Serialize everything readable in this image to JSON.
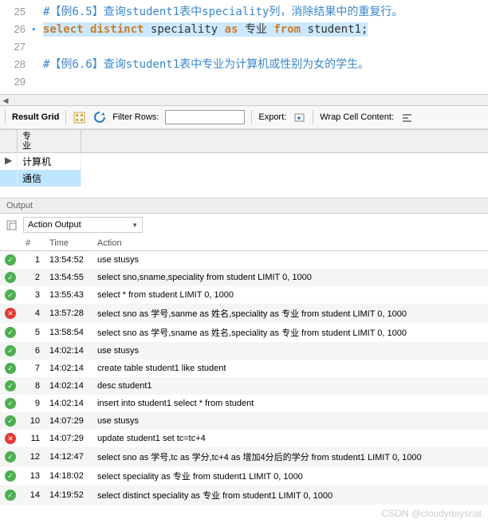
{
  "editor": {
    "lines": [
      {
        "num": 25,
        "marker": "",
        "type": "comment",
        "text": "#【例6.5】查询student1表中speciality列，消除结果中的重复行。"
      },
      {
        "num": 26,
        "marker": "●",
        "type": "sql",
        "highlighted": true,
        "tokens": [
          {
            "kind": "keyword",
            "t": "select"
          },
          {
            "kind": "sp",
            "t": " "
          },
          {
            "kind": "keyword",
            "t": "distinct"
          },
          {
            "kind": "sp",
            "t": " "
          },
          {
            "kind": "ident",
            "t": "speciality"
          },
          {
            "kind": "sp",
            "t": " "
          },
          {
            "kind": "keyword",
            "t": "as"
          },
          {
            "kind": "sp",
            "t": " "
          },
          {
            "kind": "ident",
            "t": "专业"
          },
          {
            "kind": "sp",
            "t": " "
          },
          {
            "kind": "keyword",
            "t": "from"
          },
          {
            "kind": "sp",
            "t": " "
          },
          {
            "kind": "ident",
            "t": "student1;"
          }
        ]
      },
      {
        "num": 27,
        "marker": "",
        "type": "blank",
        "text": ""
      },
      {
        "num": 28,
        "marker": "",
        "type": "comment",
        "text": "#【例6.6】查询student1表中专业为计算机或性别为女的学生。"
      },
      {
        "num": 29,
        "marker": "",
        "type": "blank",
        "text": ""
      }
    ]
  },
  "toolbar": {
    "result_grid": "Result Grid",
    "filter_label": "Filter Rows:",
    "filter_value": "",
    "export_label": "Export:",
    "wrap_label": "Wrap Cell Content:"
  },
  "grid": {
    "column": "专\n业",
    "rows": [
      {
        "val": "计算机",
        "selected": false,
        "pointer": "▶"
      },
      {
        "val": "通信",
        "selected": true,
        "pointer": ""
      }
    ]
  },
  "output": {
    "panel_title": "Output",
    "dropdown": "Action Output",
    "columns": {
      "num": "#",
      "time": "Time",
      "action": "Action"
    },
    "rows": [
      {
        "n": 1,
        "status": "ok",
        "time": "13:54:52",
        "action": "use stusys"
      },
      {
        "n": 2,
        "status": "ok",
        "time": "13:54:55",
        "action": "select sno,sname,speciality from student LIMIT 0, 1000"
      },
      {
        "n": 3,
        "status": "ok",
        "time": "13:55:43",
        "action": "select * from student LIMIT 0, 1000"
      },
      {
        "n": 4,
        "status": "err",
        "time": "13:57:28",
        "action": "select sno as 学号,sanme as 姓名,speciality as 专业 from student LIMIT 0, 1000"
      },
      {
        "n": 5,
        "status": "ok",
        "time": "13:58:54",
        "action": "select sno as 学号,sname as 姓名,speciality as 专业 from student LIMIT 0, 1000"
      },
      {
        "n": 6,
        "status": "ok",
        "time": "14:02:14",
        "action": "use stusys"
      },
      {
        "n": 7,
        "status": "ok",
        "time": "14:02:14",
        "action": "create table student1 like student"
      },
      {
        "n": 8,
        "status": "ok",
        "time": "14:02:14",
        "action": "desc student1"
      },
      {
        "n": 9,
        "status": "ok",
        "time": "14:02:14",
        "action": "insert into student1 select * from student"
      },
      {
        "n": 10,
        "status": "ok",
        "time": "14:07:29",
        "action": "use stusys"
      },
      {
        "n": 11,
        "status": "err",
        "time": "14:07:29",
        "action": "update student1 set tc=tc+4"
      },
      {
        "n": 12,
        "status": "ok",
        "time": "14:12:47",
        "action": "select sno as 学号,tc as 学分,tc+4 as 增加4分后的学分 from student1 LIMIT 0, 1000"
      },
      {
        "n": 13,
        "status": "ok",
        "time": "14:18:02",
        "action": "select speciality as 专业 from student1 LIMIT 0, 1000"
      },
      {
        "n": 14,
        "status": "ok",
        "time": "14:19:52",
        "action": "select distinct speciality as 专业 from student1 LIMIT 0, 1000"
      }
    ]
  },
  "watermark": "CSDN @cloudydayscat"
}
